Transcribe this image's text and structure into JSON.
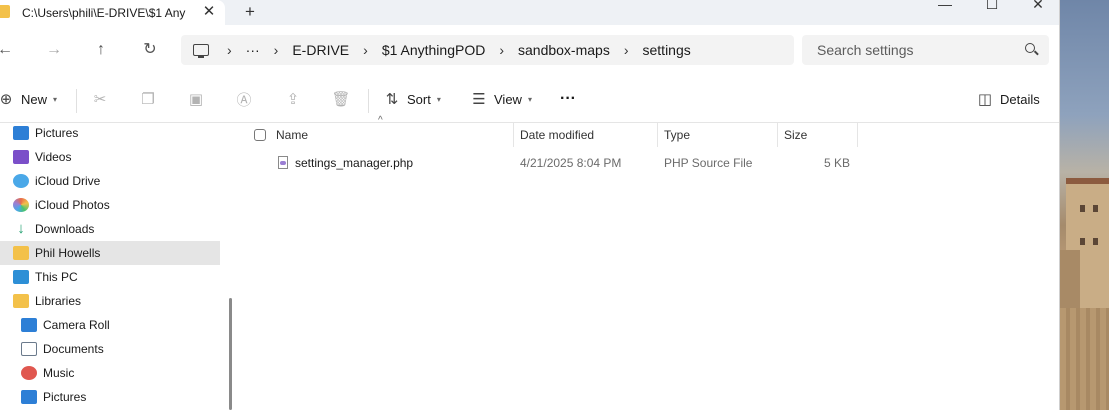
{
  "window": {
    "tab_title": "C:\\Users\\phili\\E-DRIVE\\$1 Any",
    "tab_close_glyph": "✕",
    "new_tab_glyph": "+"
  },
  "nav": {
    "back": "←",
    "forward": "→",
    "up": "↑",
    "refresh": "↻"
  },
  "address": {
    "overflow": "···",
    "crumbs": [
      "E-DRIVE",
      "$1 AnythingPOD",
      "sandbox-maps",
      "settings"
    ],
    "sep": "›"
  },
  "search": {
    "placeholder": "Search settings"
  },
  "commands": {
    "new": "New",
    "sort": "Sort",
    "view": "View",
    "more": "···",
    "details": "Details"
  },
  "sidebar": {
    "items": [
      {
        "label": "Pictures",
        "color": "#2d7fd6"
      },
      {
        "label": "Videos",
        "color": "#7b4fc9"
      },
      {
        "label": "iCloud Drive",
        "color": "#4aa8e8"
      },
      {
        "label": "iCloud Photos",
        "color": "#e86b4a"
      },
      {
        "label": "Downloads",
        "color": "#1f9e6e"
      },
      {
        "label": "Phil Howells",
        "color": "#f3c14a"
      },
      {
        "label": "This PC",
        "color": "#2d8fd6"
      },
      {
        "label": "Libraries",
        "color": "#f3c14a"
      },
      {
        "label": "Camera Roll",
        "color": "#2d7fd6"
      },
      {
        "label": "Documents",
        "color": "#6b7a8c"
      },
      {
        "label": "Music",
        "color": "#e0574f"
      },
      {
        "label": "Pictures",
        "color": "#2d7fd6"
      }
    ]
  },
  "list": {
    "columns": {
      "name": "Name",
      "date": "Date modified",
      "type": "Type",
      "size": "Size"
    },
    "rows": [
      {
        "name": "settings_manager.php",
        "date": "4/21/2025 8:04 PM",
        "type": "PHP Source File",
        "size": "5 KB"
      }
    ]
  }
}
